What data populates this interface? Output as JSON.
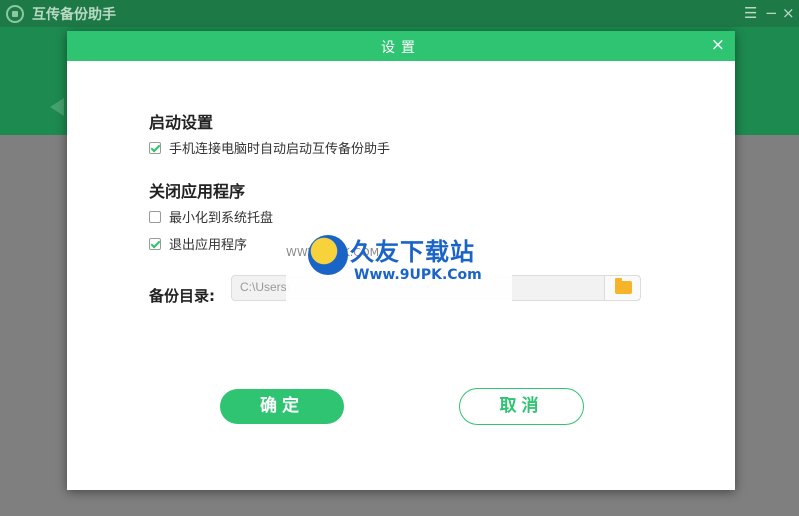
{
  "app": {
    "title": "互传备份助手",
    "controls": {
      "menu": "☰",
      "minimize": "−",
      "close": "×"
    }
  },
  "dialog": {
    "title": "设置",
    "close_icon": "×",
    "startup": {
      "heading": "启动设置",
      "options": [
        {
          "label": "手机连接电脑时自动启动互传备份助手",
          "checked": true
        }
      ]
    },
    "close_app": {
      "heading": "关闭应用程序",
      "options": [
        {
          "label": "最小化到系统托盘",
          "checked": false
        },
        {
          "label": "退出应用程序",
          "checked": true
        }
      ]
    },
    "backup_dir": {
      "label": "备份目录:",
      "value": "C:\\Users\\"
    },
    "ok_label": "确定",
    "cancel_label": "取消"
  },
  "watermark": {
    "main": "久友下载站",
    "sub": "Www.9UPK.Com",
    "left": "WWW.9UPK.COM"
  },
  "colors": {
    "accent": "#2ec471",
    "app_header": "#1d8a50",
    "folder": "#f5b42a"
  }
}
